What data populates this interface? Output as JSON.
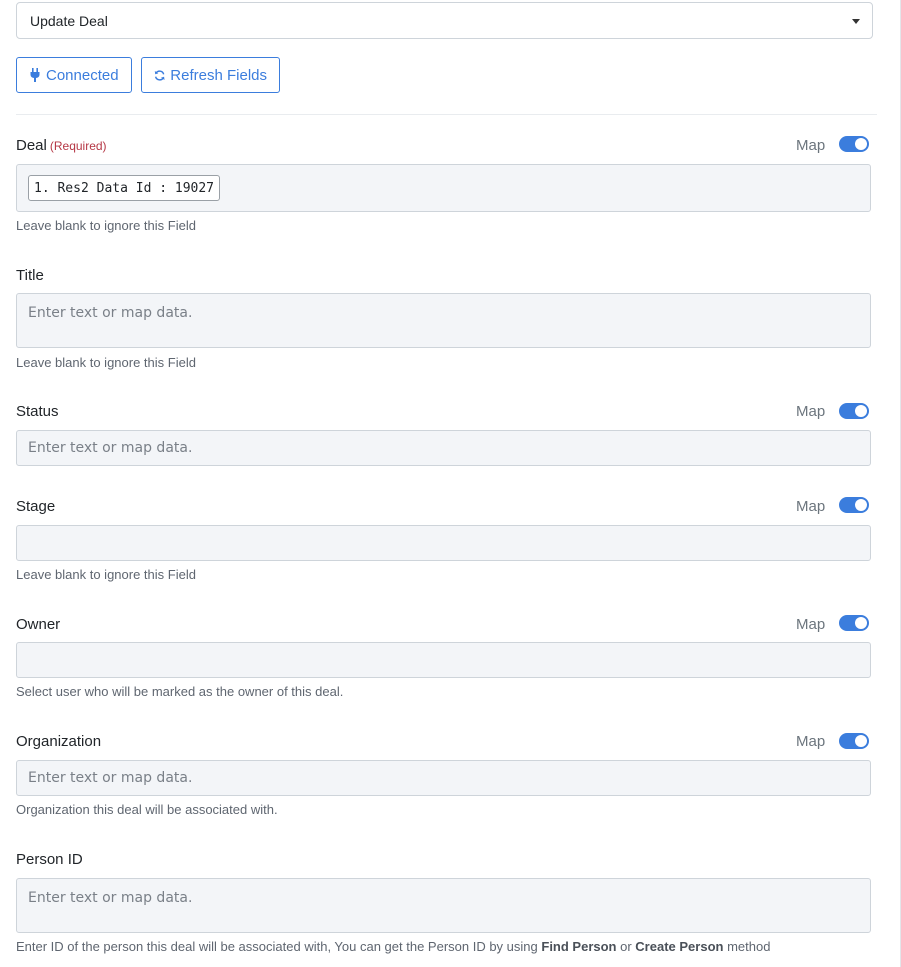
{
  "action_select": {
    "value": "Update Deal"
  },
  "buttons": {
    "connected": "Connected",
    "refresh": "Refresh Fields"
  },
  "map_label": "Map",
  "required_label": "(Required)",
  "fields": {
    "deal": {
      "label": "Deal",
      "chip": "1. Res2 Data Id : 19027",
      "help": "Leave blank to ignore this Field",
      "map_on": true
    },
    "title": {
      "label": "Title",
      "placeholder": "Enter text or map data.",
      "help": "Leave blank to ignore this Field"
    },
    "status": {
      "label": "Status",
      "placeholder": "Enter text or map data.",
      "map_on": true
    },
    "stage": {
      "label": "Stage",
      "help": "Leave blank to ignore this Field",
      "map_on": true
    },
    "owner": {
      "label": "Owner",
      "help": "Select user who will be marked as the owner of this deal.",
      "map_on": true
    },
    "organization": {
      "label": "Organization",
      "placeholder": "Enter text or map data.",
      "help": "Organization this deal will be associated with.",
      "map_on": true
    },
    "person_id": {
      "label": "Person ID",
      "placeholder": "Enter text or map data.",
      "help_prefix": "Enter ID of the person this deal will be associated with, You can get the Person ID by using ",
      "help_link1": "Find Person",
      "help_mid": " or ",
      "help_link2": "Create Person",
      "help_suffix": " method"
    }
  },
  "colors": {
    "accent": "#3b7ddd",
    "required": "#b53745",
    "input_bg": "#f3f5f8"
  }
}
